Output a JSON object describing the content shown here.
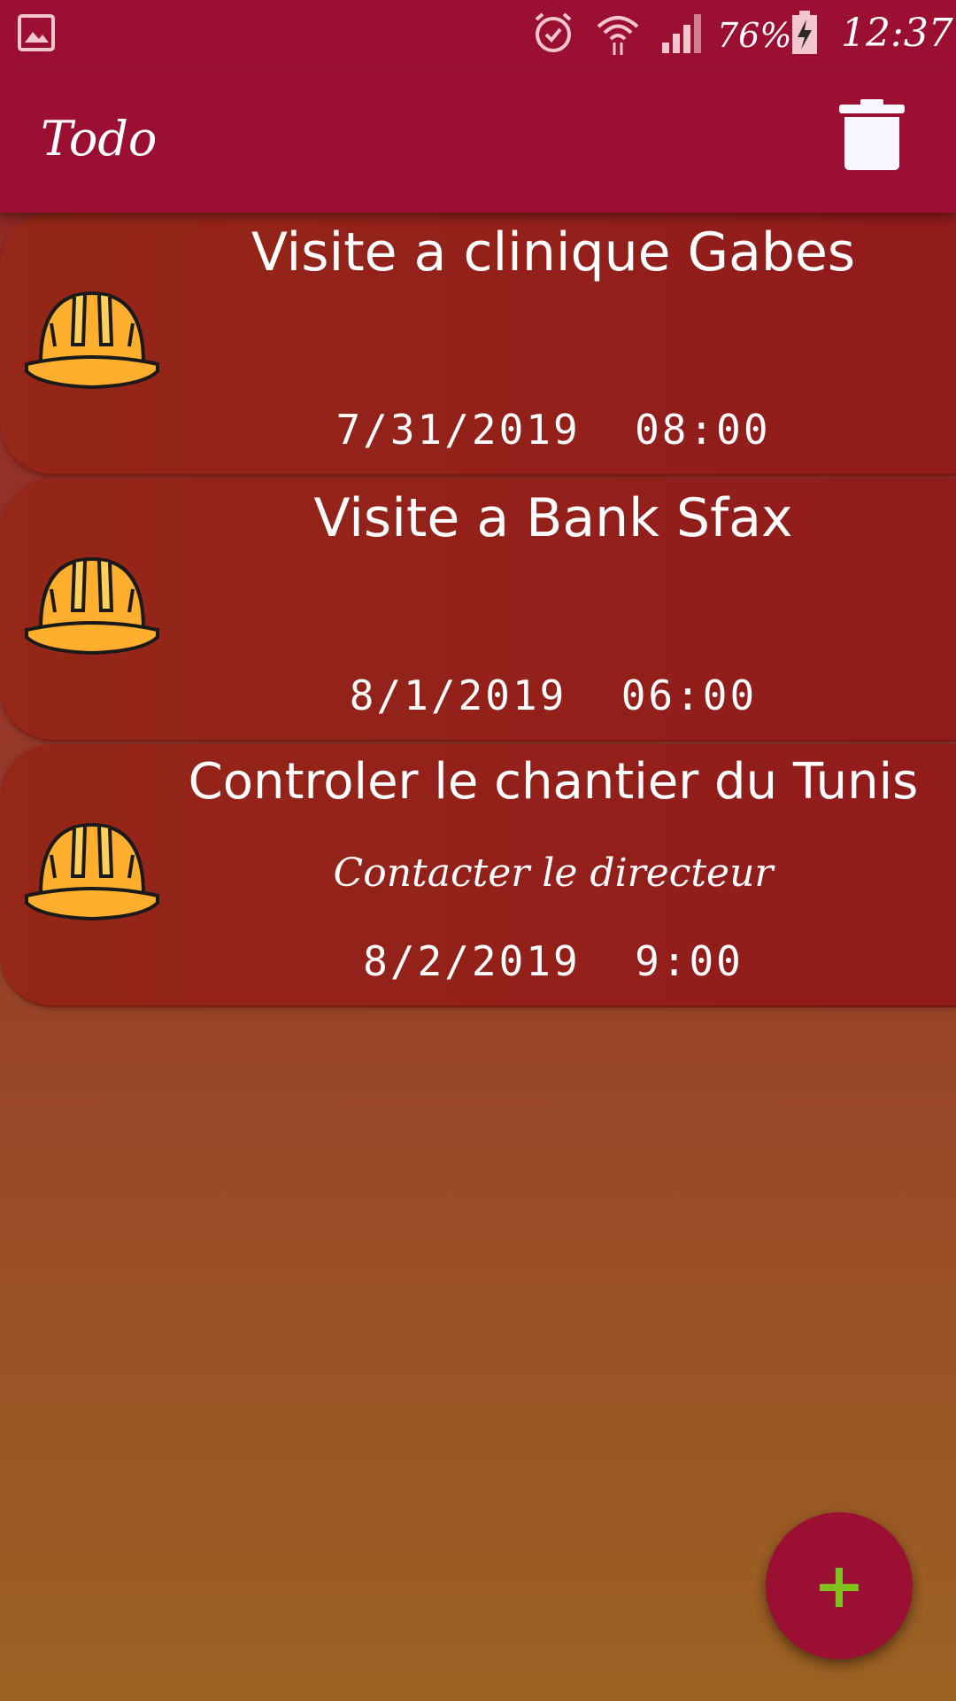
{
  "status_bar": {
    "battery_percent": "76%",
    "time": "12:37",
    "icons": [
      "image-icon",
      "alarm-icon",
      "wifi-icon",
      "signal-icon",
      "battery-charging-icon"
    ]
  },
  "app_bar": {
    "title": "Todo",
    "action_icon": "trash-icon"
  },
  "todos": [
    {
      "title": "Visite a clinique Gabes",
      "note": "",
      "date": "7/31/2019  08:00",
      "icon": "helmet-icon"
    },
    {
      "title": "Visite a Bank Sfax",
      "note": "",
      "date": "8/1/2019  06:00",
      "icon": "helmet-icon"
    },
    {
      "title": "Controler le chantier du Tunis",
      "note": "Contacter le directeur",
      "date": "8/2/2019  9:00",
      "icon": "helmet-icon"
    }
  ],
  "fab": {
    "label": "+",
    "icon": "plus-icon"
  },
  "colors": {
    "primary": "#9b0f33",
    "card": "#921b1c",
    "helmet": "#ffae2e",
    "fab_plus": "#7dc21e"
  }
}
